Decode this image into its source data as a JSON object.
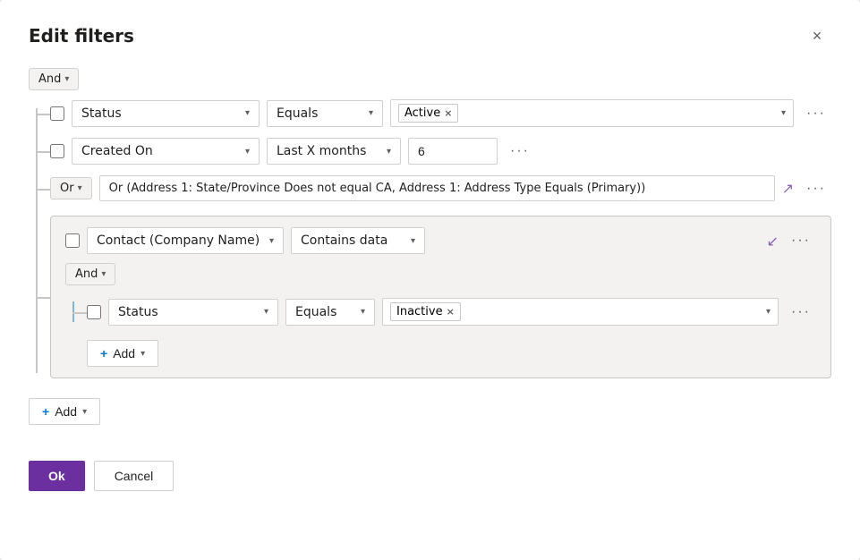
{
  "dialog": {
    "title": "Edit filters",
    "close_label": "×"
  },
  "logic_root": {
    "label": "And",
    "chevron": "▾"
  },
  "filter_rows": [
    {
      "id": "row1",
      "field": "Status",
      "operator": "Equals",
      "value_tag": "Active",
      "more": "···"
    },
    {
      "id": "row2",
      "field": "Created On",
      "operator": "Last X months",
      "value_text": "6",
      "more": "···"
    }
  ],
  "or_group": {
    "label": "Or",
    "chevron": "▾",
    "text": "Or (Address 1: State/Province Does not equal CA, Address 1: Address Type Equals (Primary))",
    "expand_icon": "↗",
    "collapse_icon": "↙",
    "more": "···"
  },
  "inner_group": {
    "field": "Contact (Company Name)",
    "operator": "Contains data",
    "collapse_icon": "↙",
    "more": "···",
    "logic_label": "And",
    "logic_chevron": "▾",
    "inner_row": {
      "field": "Status",
      "operator": "Equals",
      "value_tag": "Inactive",
      "more": "···"
    },
    "add_label": "Add",
    "add_chevron": "▾"
  },
  "root_add": {
    "label": "Add",
    "chevron": "▾"
  },
  "footer": {
    "ok_label": "Ok",
    "cancel_label": "Cancel"
  }
}
